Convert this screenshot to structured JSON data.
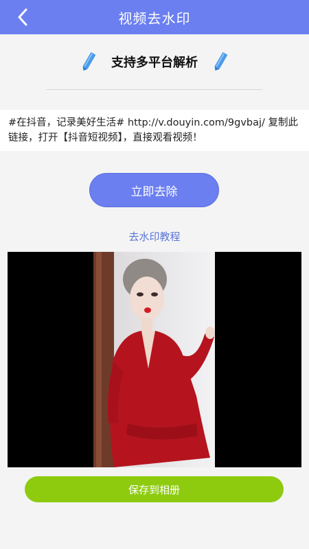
{
  "header": {
    "title": "视频去水印",
    "background": "#6b7ff0"
  },
  "banner": {
    "title": "支持多平台解析"
  },
  "link_input": {
    "value": "#在抖音，记录美好生活# http://v.douyin.com/9gvbaj/ 复制此链接，打开【抖音短视频】，直接观看视频！"
  },
  "actions": {
    "remove_label": "立即去除",
    "tutorial_label": "去水印教程",
    "save_label": "保存到相册",
    "save_color": "#8ecb0f"
  },
  "icons": {
    "back": "back-arrow-icon",
    "pen": "pen-icon"
  }
}
